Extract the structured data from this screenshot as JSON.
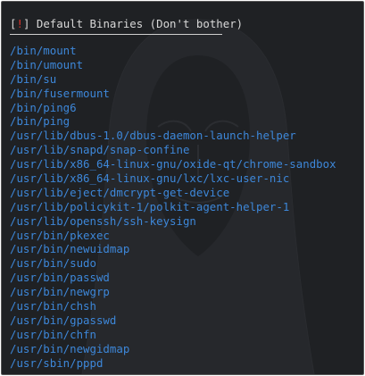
{
  "header": {
    "open_bracket": "[",
    "marker": "!",
    "close_bracket": "]",
    "title": " Default Binaries (Don't bother)"
  },
  "binaries": [
    "/bin/mount",
    "/bin/umount",
    "/bin/su",
    "/bin/fusermount",
    "/bin/ping6",
    "/bin/ping",
    "/usr/lib/dbus-1.0/dbus-daemon-launch-helper",
    "/usr/lib/snapd/snap-confine",
    "/usr/lib/x86_64-linux-gnu/oxide-qt/chrome-sandbox",
    "/usr/lib/x86_64-linux-gnu/lxc/lxc-user-nic",
    "/usr/lib/eject/dmcrypt-get-device",
    "/usr/lib/policykit-1/polkit-agent-helper-1",
    "/usr/lib/openssh/ssh-keysign",
    "/usr/bin/pkexec",
    "/usr/bin/newuidmap",
    "/usr/bin/sudo",
    "/usr/bin/passwd",
    "/usr/bin/newgrp",
    "/usr/bin/chsh",
    "/usr/bin/gpasswd",
    "/usr/bin/chfn",
    "/usr/bin/newgidmap",
    "/usr/sbin/pppd"
  ],
  "colors": {
    "background": "#1f2124",
    "text": "#d8d8d8",
    "marker": "#e0342c",
    "path": "#3d87d9"
  }
}
